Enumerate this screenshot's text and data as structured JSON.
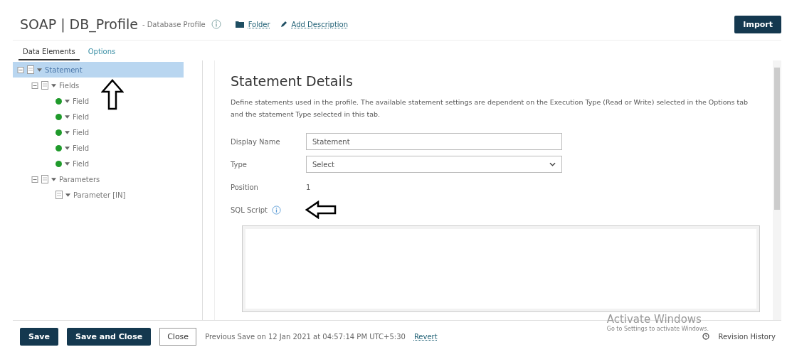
{
  "header": {
    "title": "SOAP | DB_Profile",
    "subtitle": "- Database Profile",
    "folder_link": "Folder",
    "description_link": "Add Description",
    "import_button": "Import"
  },
  "tabs": [
    {
      "label": "Data Elements",
      "selected": true
    },
    {
      "label": "Options",
      "selected": false
    }
  ],
  "tree": [
    {
      "label": "Statement",
      "kind": "group",
      "expanded": true,
      "selected": true,
      "children": [
        {
          "label": "Fields",
          "kind": "group",
          "expanded": true,
          "selected": false,
          "children": [
            {
              "label": "Field",
              "kind": "field",
              "selected": false
            },
            {
              "label": "Field",
              "kind": "field",
              "selected": false
            },
            {
              "label": "Field",
              "kind": "field",
              "selected": false
            },
            {
              "label": "Field",
              "kind": "field",
              "selected": false
            },
            {
              "label": "Field",
              "kind": "field",
              "selected": false
            }
          ]
        },
        {
          "label": "Parameters",
          "kind": "group",
          "expanded": true,
          "selected": false,
          "children": [
            {
              "label": "Parameter [IN]",
              "kind": "param",
              "selected": false
            }
          ]
        }
      ]
    }
  ],
  "details": {
    "heading": "Statement Details",
    "description": "Define statements used in the profile. The available statement settings are dependent on the Execution Type (Read or Write) selected in the Options tab and the statement Type selected in this tab.",
    "display_name_label": "Display Name",
    "display_name_value": "Statement",
    "type_label": "Type",
    "type_value": "Select",
    "position_label": "Position",
    "position_value": "1",
    "sql_label": "SQL Script"
  },
  "footer": {
    "save": "Save",
    "save_close": "Save and Close",
    "close": "Close",
    "previous_save": "Previous Save on 12 Jan 2021 at 04:57:14 PM UTC+5:30",
    "revert": "Revert",
    "revision_history": "Revision History"
  },
  "os_notice": {
    "title": "Activate Windows",
    "text": "Go to Settings to activate Windows."
  }
}
